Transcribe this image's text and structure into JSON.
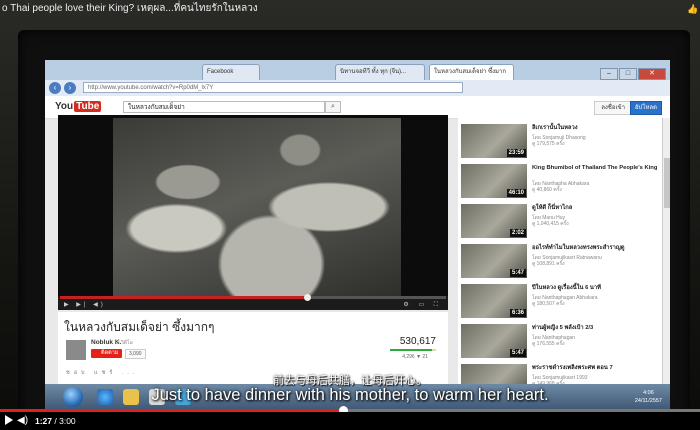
{
  "outer": {
    "title": "o Thai people love their King? เหตุผล...ที่คนไทยรักในหลวง",
    "time_current": "1:27",
    "time_total": "3:00",
    "progress": 0.49
  },
  "subtitles": {
    "chinese": "前去与母后共膳，让母后开心。",
    "english": "Just to have dinner with his mother, to warm her heart."
  },
  "browser": {
    "tabs": [
      "Facebook",
      "นิทานจอทีวี ทั้ง ทุก (จีน)...",
      "ในหลวงกับสมเด็จย่า ซึ้งมาก"
    ],
    "url": "http://www.youtube.com/watch?v=Rp0dM_lx7Y"
  },
  "youtube": {
    "search_value": "ในหลวงกับสมเด็จย่า",
    "signin_label": "ลงชื่อเข้า",
    "upload_label": "อัปโหลด",
    "player_progress": 0.64
  },
  "video": {
    "title": "ในหลวงกับสมเด็จย่า ซึ้งมากๆ",
    "channel": "Nobluk K.",
    "channel_videos": "79 วิดีโอ",
    "subscribe_label": "ติดตาม",
    "sub_count": "3,090",
    "views": "530,617",
    "likes": "4,296  ▼ 21",
    "actions": "ชอบ  แชร์  ..."
  },
  "related": [
    {
      "title": "ลิเกเรานั้นในหลวง",
      "channel": "โดย Sonjamuji Dhasong",
      "views": "ดู 179,575 ครั้ง",
      "duration": "23:59"
    },
    {
      "title": "King Bhumibol of Thailand The People's King",
      "channel": "โดย Nanthapha Abhakara",
      "views": "ดู 40,860 ครั้ง",
      "duration": "46:10"
    },
    {
      "title": "ดูให้ดี ก็นี่หาไกล",
      "channel": "โดย Manu Huy",
      "views": "ดู 1,040,415 ครั้ง",
      "duration": "2:02"
    },
    {
      "title": "ออไรท์ทำไมในหลวงทรงพระสำราญดู",
      "channel": "โดย Sonjamujikasrt Ratnawanu",
      "views": "ดู 108,891 ครั้ง",
      "duration": "5:47"
    },
    {
      "title": "ปีในหลวง ดูเรื่องนี้ใน 6 นาที",
      "channel": "โดย Nanthaphagan Abhakara",
      "views": "ดู 180,507 ครั้ง",
      "duration": "6:36"
    },
    {
      "title": "ท่านผู้หญิง 5 พลังเป้า 2/3",
      "channel": "โดย Nanthaphagan",
      "views": "ดู 176,555 ครั้ง",
      "duration": "5:47"
    },
    {
      "title": "พระราชดำรงเพลิงพระศพ ตอน 7",
      "channel": "โดย Sonjamujikasrt 1993",
      "views": "ดู 149,968 ครั้ง",
      "duration": "3:47"
    }
  ],
  "taskbar": {
    "clock_time": "4:06",
    "clock_date": "24/11/2557"
  }
}
